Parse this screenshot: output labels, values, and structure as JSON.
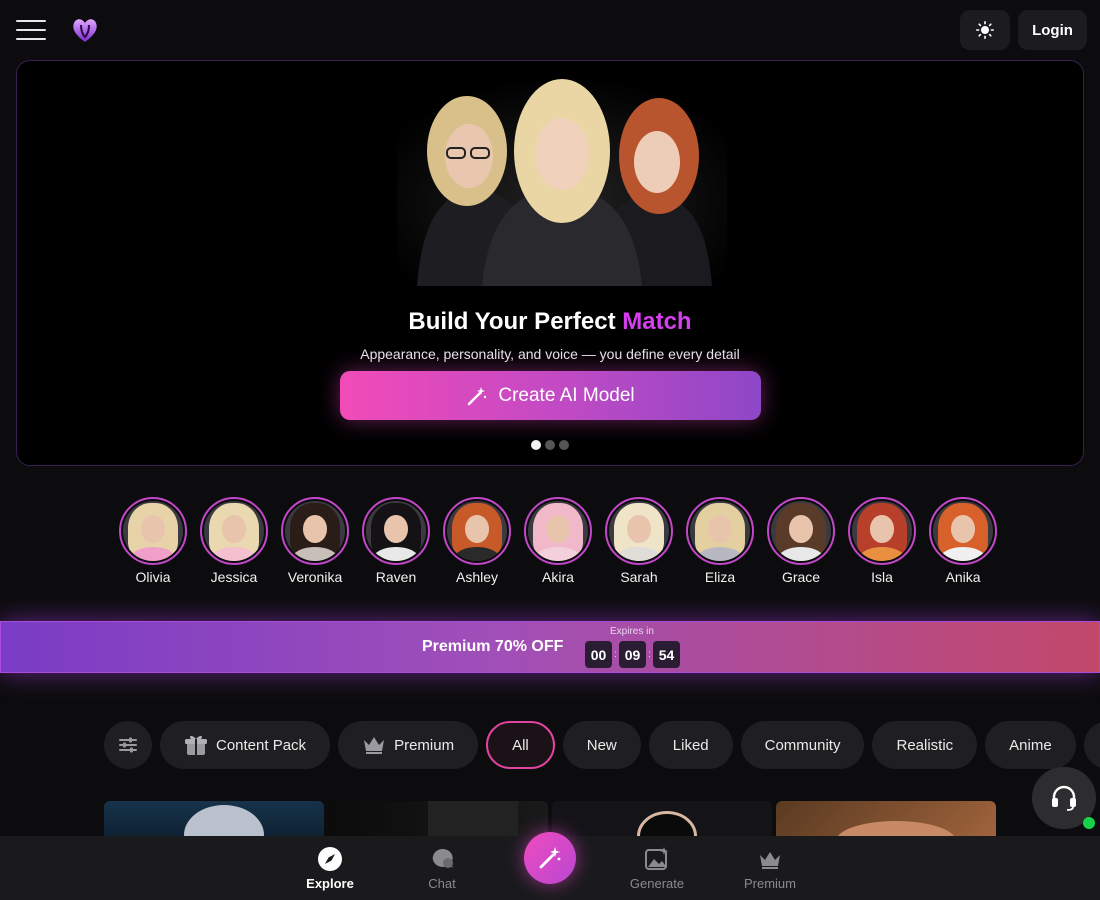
{
  "header": {
    "login_label": "Login"
  },
  "hero": {
    "title_main": "Build Your Perfect",
    "title_accent": "Match",
    "subtitle": "Appearance, personality, and voice — you define every detail",
    "cta_label": "Create AI Model",
    "slide_count": 3,
    "active_slide": 1
  },
  "stories": [
    {
      "name": "Olivia",
      "hair": "#e8d2a8",
      "body": "#f0a0c8"
    },
    {
      "name": "Jessica",
      "hair": "#ead8b0",
      "body": "#f4c0d0"
    },
    {
      "name": "Veronika",
      "hair": "#2a1c16",
      "body": "#c8c0b8"
    },
    {
      "name": "Raven",
      "hair": "#141214",
      "body": "#e8e8e8"
    },
    {
      "name": "Ashley",
      "hair": "#c85a2a",
      "body": "#2a2a2a"
    },
    {
      "name": "Akira",
      "hair": "#f0b8c8",
      "body": "#f4d0dc"
    },
    {
      "name": "Sarah",
      "hair": "#f0e4c8",
      "body": "#e0dcd8"
    },
    {
      "name": "Eliza",
      "hair": "#e4cfa0",
      "body": "#b8b8c0"
    },
    {
      "name": "Grace",
      "hair": "#5a3a28",
      "body": "#e8e8e8"
    },
    {
      "name": "Isla",
      "hair": "#b8402a",
      "body": "#e89040"
    },
    {
      "name": "Anika",
      "hair": "#d8602a",
      "body": "#f0f0f0"
    }
  ],
  "promo": {
    "text": "Premium 70% OFF",
    "expires_label": "Expires in",
    "hours": "00",
    "minutes": "09",
    "seconds": "54"
  },
  "filters": {
    "items": [
      {
        "label": "Content Pack",
        "icon": "gift-box-icon"
      },
      {
        "label": "Premium",
        "icon": "crown-icon"
      },
      {
        "label": "All",
        "active": true
      },
      {
        "label": "New"
      },
      {
        "label": "Liked"
      },
      {
        "label": "Community"
      },
      {
        "label": "Realistic"
      },
      {
        "label": "Anime"
      }
    ]
  },
  "bottom_nav": {
    "explore": "Explore",
    "chat": "Chat",
    "generate": "Generate",
    "premium": "Premium"
  },
  "colors": {
    "accent": "#d63ef0",
    "active_chip_border": "#e0449e",
    "online": "#18d14a"
  }
}
